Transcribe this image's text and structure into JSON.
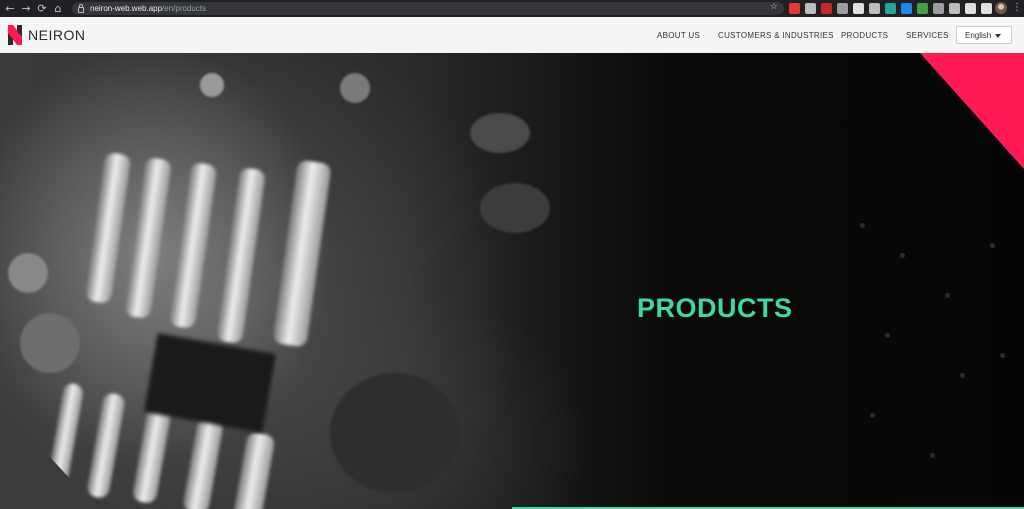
{
  "browser": {
    "url_host": "neiron-web.web.app",
    "url_path": "/en/products",
    "extension_colors": [
      "#e53935",
      "#bdbdbd",
      "#c62828",
      "#9e9e9e",
      "#e0e0e0",
      "#bdbdbd",
      "#26a69a",
      "#1e88e5",
      "#43a047",
      "#9e9e9e",
      "#bdbdbd",
      "#e0e0e0",
      "#e0e0e0"
    ]
  },
  "header": {
    "brand": "NEIRON",
    "nav": {
      "about": "ABOUT US",
      "customers": "CUSTOMERS & INDUSTRIES",
      "products": "PRODUCTS",
      "services": "SERVICES"
    },
    "language": "English"
  },
  "hero": {
    "title": "PRODUCTS",
    "accent_color": "#3ed8a0",
    "corner_color": "#ff1a55"
  }
}
